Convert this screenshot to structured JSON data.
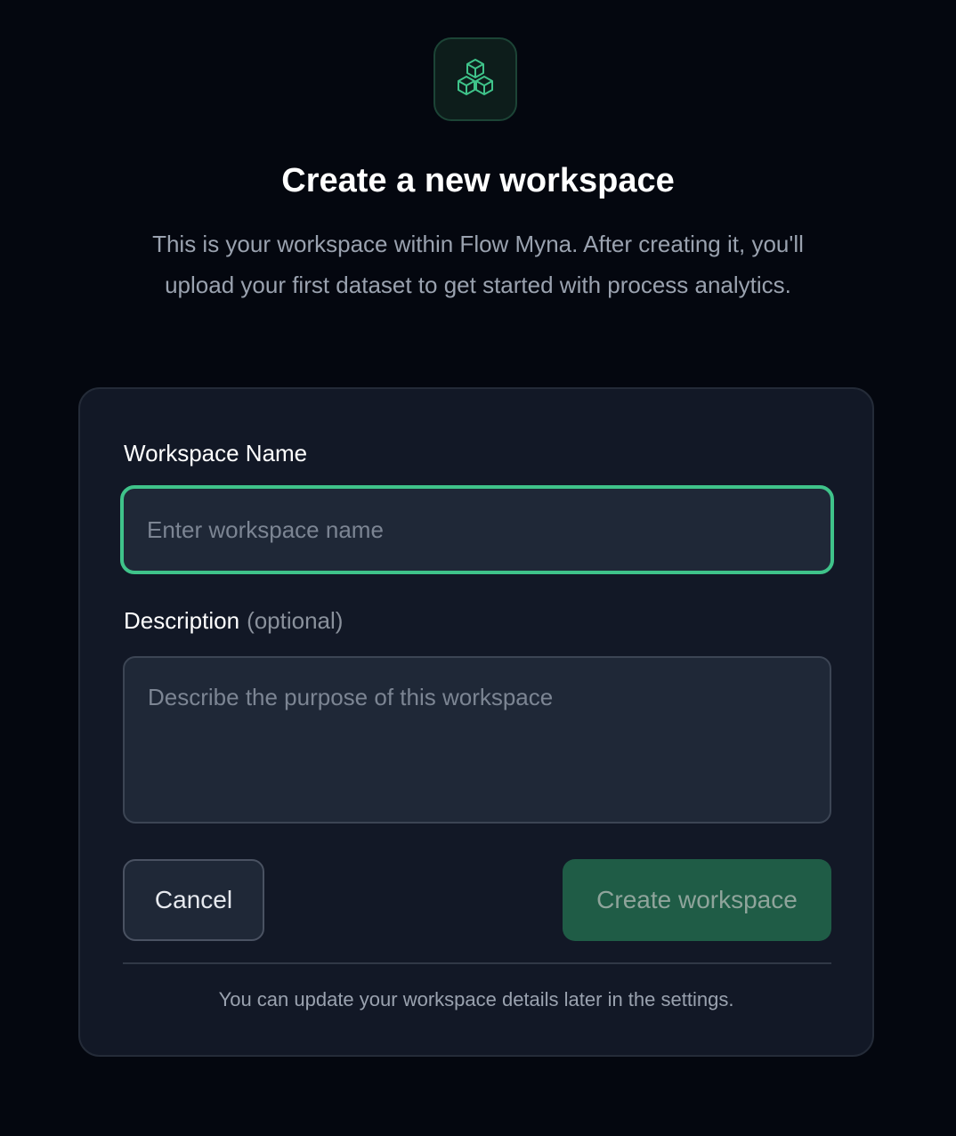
{
  "header": {
    "logo_icon": "cubes-icon",
    "title": "Create a new workspace",
    "subtitle": "This is your workspace within Flow Myna. After creating it, you'll upload your first dataset to get started with process analytics."
  },
  "form": {
    "name_label": "Workspace Name",
    "name_placeholder": "Enter workspace name",
    "name_value": "",
    "description_label": "Description",
    "description_hint": "(optional)",
    "description_placeholder": "Describe the purpose of this workspace",
    "description_value": "",
    "cancel_label": "Cancel",
    "create_label": "Create workspace",
    "footer_note": "You can update your workspace details later in the settings."
  },
  "colors": {
    "background": "#04070f",
    "card": "#121826",
    "accent": "#3fc38a",
    "primary_button": "#1f5c46"
  }
}
